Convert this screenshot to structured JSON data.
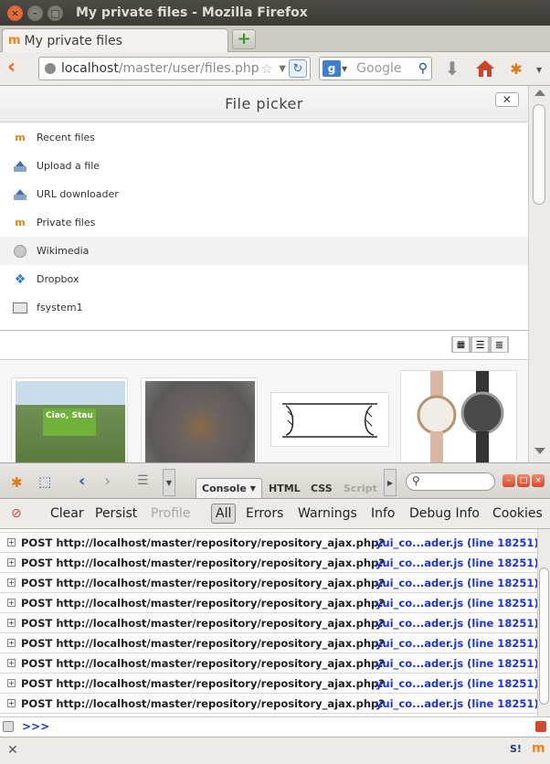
{
  "window": {
    "title": "My private files - Mozilla Firefox"
  },
  "tabs": [
    {
      "label": "My private files"
    }
  ],
  "navbar": {
    "url_host": "localhost",
    "url_path": "/master/user/files.php",
    "search_engine": "g",
    "search_placeholder": "Google"
  },
  "file_picker": {
    "title": "File picker",
    "close_label": "✕",
    "repositories": [
      {
        "label": "Recent files",
        "icon": "moodle-icon"
      },
      {
        "label": "Upload a file",
        "icon": "upload-icon"
      },
      {
        "label": "URL downloader",
        "icon": "url-download-icon"
      },
      {
        "label": "Private files",
        "icon": "moodle-icon"
      },
      {
        "label": "Wikimedia",
        "icon": "wikimedia-icon",
        "active": true
      },
      {
        "label": "Dropbox",
        "icon": "dropbox-icon"
      },
      {
        "label": "fsystem1",
        "icon": "filesystem-icon"
      }
    ],
    "thumb_labels": [
      "Ciao, Stau"
    ]
  },
  "firebug": {
    "panel_tabs": [
      {
        "label": "Console",
        "selected": true
      },
      {
        "label": "HTML"
      },
      {
        "label": "CSS"
      },
      {
        "label": "Script",
        "disabled": true
      }
    ],
    "console_toolbar": [
      {
        "label": "Clear"
      },
      {
        "label": "Persist"
      },
      {
        "label": "Profile",
        "disabled": true
      },
      {
        "label": "All",
        "selected": true
      },
      {
        "label": "Errors"
      },
      {
        "label": "Warnings"
      },
      {
        "label": "Info"
      },
      {
        "label": "Debug Info"
      },
      {
        "label": "Cookies"
      }
    ],
    "log_rows": [
      {
        "text": "POST http://localhost/master/repository/repository_ajax.php?",
        "source": "yui_co...ader.js (line 18251)"
      },
      {
        "text": "POST http://localhost/master/repository/repository_ajax.php?",
        "source": "yui_co...ader.js (line 18251)"
      },
      {
        "text": "POST http://localhost/master/repository/repository_ajax.php?",
        "source": "yui_co...ader.js (line 18251)"
      },
      {
        "text": "POST http://localhost/master/repository/repository_ajax.php?",
        "source": "yui_co...ader.js (line 18251)"
      },
      {
        "text": "POST http://localhost/master/repository/repository_ajax.php?",
        "source": "yui_co...ader.js (line 18251)"
      },
      {
        "text": "POST http://localhost/master/repository/repository_ajax.php?",
        "source": "yui_co...ader.js (line 18251)"
      },
      {
        "text": "POST http://localhost/master/repository/repository_ajax.php?",
        "source": "yui_co...ader.js (line 18251)"
      },
      {
        "text": "POST http://localhost/master/repository/repository_ajax.php?",
        "source": "yui_co...ader.js (line 18251)"
      },
      {
        "text": "POST http://localhost/master/repository/repository_ajax.php?",
        "source": "yui_co...ader.js (line 18251)"
      }
    ],
    "command_prompt": ">>>"
  },
  "colors": {
    "accent": "#e06a1d",
    "link_blue": "#1d35d8",
    "moodle_orange": "#f98012"
  }
}
